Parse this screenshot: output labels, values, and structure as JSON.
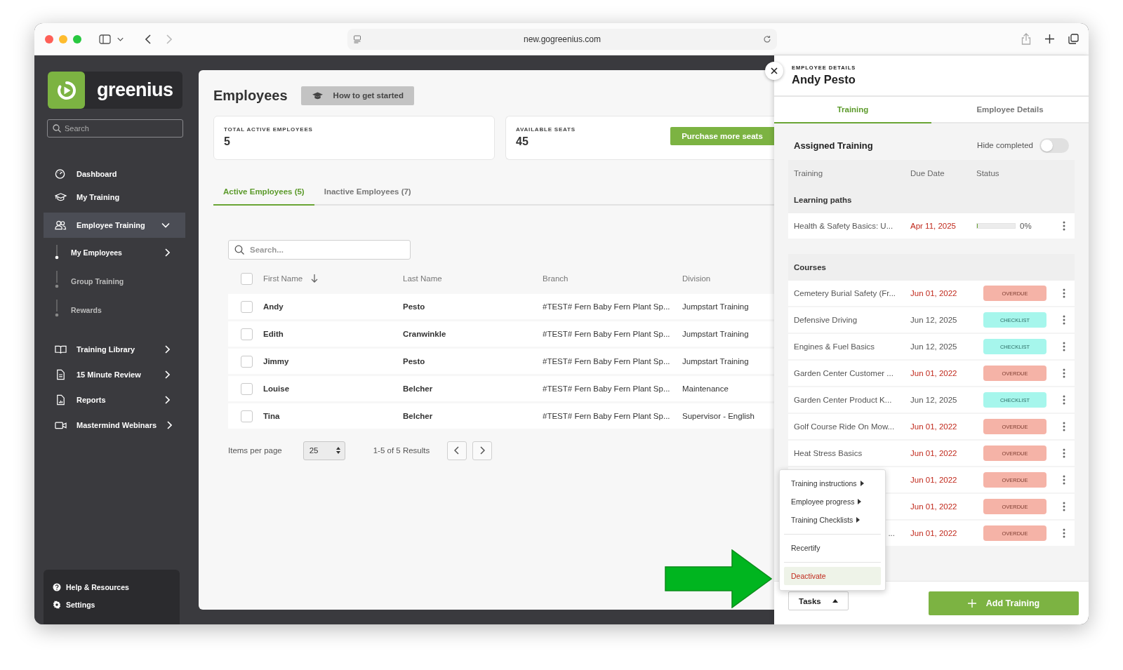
{
  "browser": {
    "url": "new.gogreenius.com"
  },
  "sidebar": {
    "logo": "greenius",
    "search": {
      "placeholder": "Search"
    },
    "items": [
      {
        "label": "Dashboard",
        "kind": "link",
        "selected": false
      },
      {
        "label": "My Training",
        "kind": "link",
        "selected": false
      },
      {
        "label": "Employee Training",
        "kind": "group",
        "selected": true,
        "expanded": true,
        "children": [
          {
            "label": "My Employees",
            "kind": "group",
            "selected": true
          },
          {
            "label": "Group Training",
            "kind": "link",
            "selected": false
          },
          {
            "label": "Rewards",
            "kind": "link",
            "selected": false
          }
        ]
      },
      {
        "label": "Training Library",
        "kind": "group",
        "selected": false,
        "expanded": false
      },
      {
        "label": "15 Minute Review",
        "kind": "group",
        "selected": false,
        "expanded": false
      },
      {
        "label": "Reports",
        "kind": "group",
        "selected": false,
        "expanded": false
      },
      {
        "label": "Mastermind Webinars",
        "kind": "group",
        "selected": false,
        "expanded": false
      }
    ],
    "footer": [
      {
        "label": "Help & Resources"
      },
      {
        "label": "Settings"
      }
    ]
  },
  "page": {
    "title": "Employees",
    "help_button": "How to get started",
    "stats": [
      {
        "label": "TOTAL ACTIVE EMPLOYEES",
        "value": "5"
      },
      {
        "label": "AVAILABLE SEATS",
        "value": "45",
        "action": "Purchase more seats"
      }
    ],
    "tabs": [
      {
        "label": "Active Employees (5)",
        "selected": true
      },
      {
        "label": "Inactive Employees (7)",
        "selected": false
      }
    ],
    "search": {
      "placeholder": "Search..."
    },
    "table": {
      "header_checked": false,
      "columns": [
        "First Name",
        "Last Name",
        "Branch",
        "Division"
      ],
      "rows": [
        {
          "checked": false,
          "cells": [
            "Andy",
            "Pesto",
            "#TEST# Fern Baby Fern Plant Sp...",
            "Jumpstart Training"
          ]
        },
        {
          "checked": false,
          "cells": [
            "Edith",
            "Cranwinkle",
            "#TEST# Fern Baby Fern Plant Sp...",
            "Jumpstart Training"
          ]
        },
        {
          "checked": false,
          "cells": [
            "Jimmy",
            "Pesto",
            "#TEST# Fern Baby Fern Plant Sp...",
            "Jumpstart Training"
          ]
        },
        {
          "checked": false,
          "cells": [
            "Louise",
            "Belcher",
            "#TEST# Fern Baby Fern Plant Sp...",
            "Maintenance"
          ]
        },
        {
          "checked": false,
          "cells": [
            "Tina",
            "Belcher",
            "#TEST# Fern Baby Fern Plant Sp...",
            "Supervisor - English"
          ]
        }
      ]
    },
    "pagination": {
      "label": "Items per page",
      "page_size": "25",
      "summary": "1-5 of 5 Results"
    }
  },
  "details": {
    "eyebrow": "EMPLOYEE DETAILS",
    "name": "Andy Pesto",
    "tabs": [
      {
        "label": "Training",
        "selected": true
      },
      {
        "label": "Employee Details",
        "selected": false
      }
    ],
    "section_title": "Assigned Training",
    "hide_completed": {
      "label": "Hide completed",
      "on": false
    },
    "columns": [
      "Training",
      "Due Date",
      "Status"
    ],
    "groups": [
      {
        "title": "Learning paths",
        "rows": [
          {
            "name": "Health & Safety Basics: U...",
            "due": "Apr 11, 2025",
            "late": true,
            "status": {
              "kind": "progress",
              "level": 0,
              "reading": "0%"
            }
          }
        ]
      },
      {
        "title": "Courses",
        "rows": [
          {
            "name": "Cemetery Burial Safety (Fr...",
            "due": "Jun 01, 2022",
            "late": true,
            "status": {
              "kind": "overdue",
              "label": "OVERDUE"
            }
          },
          {
            "name": "Defensive Driving",
            "due": "Jun 12, 2025",
            "late": false,
            "status": {
              "kind": "checklist",
              "label": "CHECKLIST"
            }
          },
          {
            "name": "Engines & Fuel Basics",
            "due": "Jun 12, 2025",
            "late": false,
            "status": {
              "kind": "checklist",
              "label": "CHECKLIST"
            }
          },
          {
            "name": "Garden Center Customer ...",
            "due": "Jun 01, 2022",
            "late": true,
            "status": {
              "kind": "overdue",
              "label": "OVERDUE"
            }
          },
          {
            "name": "Garden Center Product K...",
            "due": "Jun 12, 2025",
            "late": false,
            "status": {
              "kind": "checklist",
              "label": "CHECKLIST"
            }
          },
          {
            "name": "Golf Course Ride On Mow...",
            "due": "Jun 01, 2022",
            "late": true,
            "status": {
              "kind": "overdue",
              "label": "OVERDUE"
            }
          },
          {
            "name": "Heat Stress Basics",
            "due": "Jun 01, 2022",
            "late": true,
            "status": {
              "kind": "overdue",
              "label": "OVERDUE"
            }
          },
          {
            "due": "Jun 01, 2022",
            "late": true,
            "status": {
              "kind": "overdue",
              "label": "OVERDUE"
            }
          },
          {
            "due": "Jun 01, 2022",
            "late": true,
            "status": {
              "kind": "overdue",
              "label": "OVERDUE"
            }
          },
          {
            "name": "...",
            "covered": true,
            "due": "Jun 01, 2022",
            "late": true,
            "status": {
              "kind": "overdue",
              "label": "OVERDUE"
            }
          }
        ]
      }
    ],
    "tasks_button": "Tasks",
    "add_button": "Add Training",
    "menu": [
      [
        {
          "label": "Training instructions",
          "kind": "submenu",
          "highlighted": false
        },
        {
          "label": "Employee progress",
          "kind": "submenu",
          "highlighted": false
        },
        {
          "label": "Training Checklists",
          "kind": "submenu",
          "highlighted": false
        }
      ],
      [
        {
          "label": "Recertify",
          "kind": "action",
          "highlighted": false
        }
      ],
      [
        {
          "label": "Deactivate",
          "kind": "danger",
          "highlighted": true
        }
      ]
    ]
  }
}
